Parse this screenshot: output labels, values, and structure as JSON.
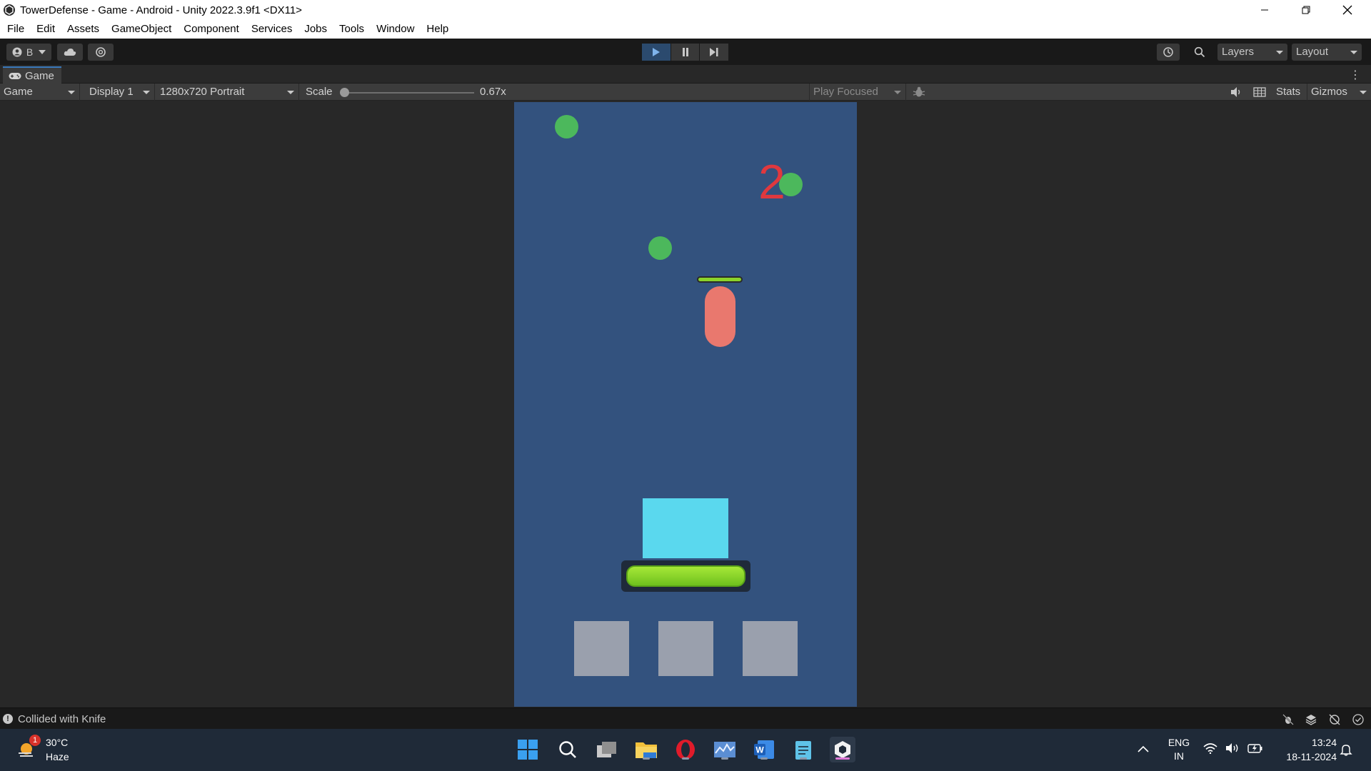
{
  "window": {
    "title": "TowerDefense - Game - Android - Unity 2022.3.9f1 <DX11>"
  },
  "menu": [
    "File",
    "Edit",
    "Assets",
    "GameObject",
    "Component",
    "Services",
    "Jobs",
    "Tools",
    "Window",
    "Help"
  ],
  "toolbar": {
    "account_label": "B",
    "layers_label": "Layers",
    "layout_label": "Layout"
  },
  "tab": {
    "label": "Game"
  },
  "game_controls": {
    "view_mode": "Game",
    "display": "Display 1",
    "resolution": "1280x720 Portrait",
    "scale_label": "Scale",
    "scale_value": "0.67x",
    "play_mode": "Play Focused",
    "stats_label": "Stats",
    "gizmos_label": "Gizmos"
  },
  "game": {
    "score": "2",
    "enemy_health_fraction": 1.0,
    "tower_health_fraction": 1.0,
    "slot_count": 3
  },
  "status": {
    "message": "Collided with Knife"
  },
  "taskbar": {
    "weather_temp": "30°C",
    "weather_desc": "Haze",
    "weather_badge": "1",
    "lang_top": "ENG",
    "lang_bottom": "IN",
    "time": "13:24",
    "date": "18-11-2024"
  },
  "colors": {
    "viewport_bg": "#33527e",
    "enemy": "#e9786e",
    "tower": "#5ad8ee",
    "dot": "#4cb85c",
    "score": "#e0383e"
  }
}
